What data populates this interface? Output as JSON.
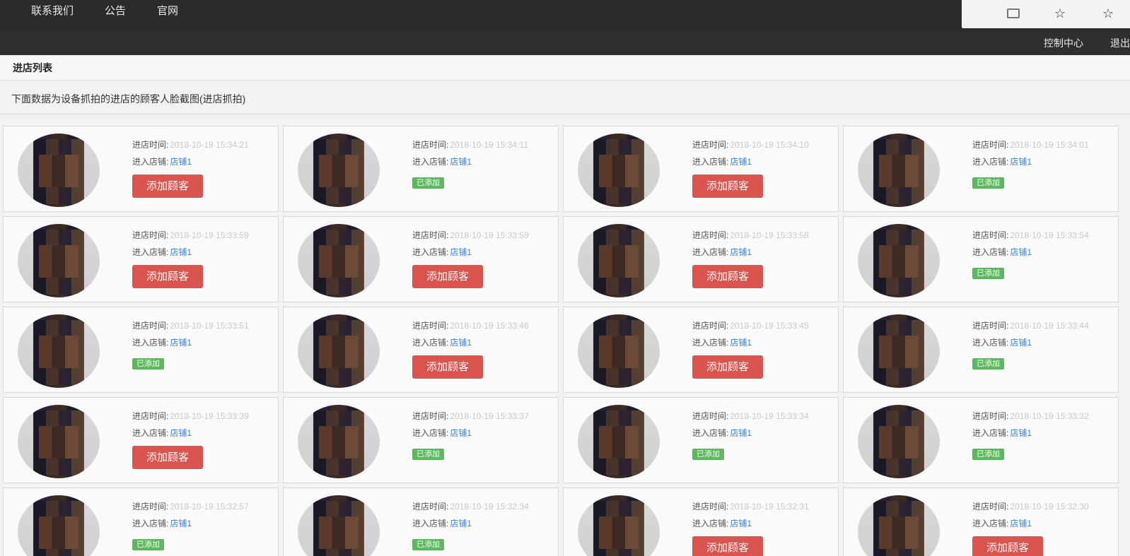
{
  "nav": {
    "items": [
      "联系我们",
      "公告",
      "官网"
    ]
  },
  "header_right": {
    "control_center": "控制中心",
    "logout": "退出"
  },
  "panel": {
    "title": "进店列表",
    "description": "下面数据为设备抓拍的进店的顾客人脸截图(进店抓拍)"
  },
  "labels": {
    "time_label": "进店时间:",
    "shop_label": "进入店铺:",
    "add_button": "添加顾客",
    "added_badge": "已添加"
  },
  "records": [
    {
      "time": "2018-10-19 15:34:21",
      "shop": "店铺1",
      "status": "add"
    },
    {
      "time": "2018-10-19 15:34:11",
      "shop": "店铺1",
      "status": "added"
    },
    {
      "time": "2018-10-19 15:34:10",
      "shop": "店铺1",
      "status": "add"
    },
    {
      "time": "2018-10-19 15:34:01",
      "shop": "店铺1",
      "status": "added"
    },
    {
      "time": "2018-10-19 15:33:59",
      "shop": "店铺1",
      "status": "add"
    },
    {
      "time": "2018-10-19 15:33:59",
      "shop": "店铺1",
      "status": "add"
    },
    {
      "time": "2018-10-19 15:33:58",
      "shop": "店铺1",
      "status": "add"
    },
    {
      "time": "2018-10-19 15:33:54",
      "shop": "店铺1",
      "status": "added"
    },
    {
      "time": "2018-10-19 15:33:51",
      "shop": "店铺1",
      "status": "added"
    },
    {
      "time": "2018-10-19 15:33:46",
      "shop": "店铺1",
      "status": "add"
    },
    {
      "time": "2018-10-19 15:33:45",
      "shop": "店铺1",
      "status": "add"
    },
    {
      "time": "2018-10-19 15:33:44",
      "shop": "店铺1",
      "status": "added"
    },
    {
      "time": "2018-10-19 15:33:39",
      "shop": "店铺1",
      "status": "add"
    },
    {
      "time": "2018-10-19 15:33:37",
      "shop": "店铺1",
      "status": "added"
    },
    {
      "time": "2018-10-19 15:33:34",
      "shop": "店铺1",
      "status": "added"
    },
    {
      "time": "2018-10-19 15:33:32",
      "shop": "店铺1",
      "status": "added"
    },
    {
      "time": "2018-10-19 15:32:57",
      "shop": "店铺1",
      "status": "added"
    },
    {
      "time": "2018-10-19 15:32:34",
      "shop": "店铺1",
      "status": "added"
    },
    {
      "time": "2018-10-19 15:32:31",
      "shop": "店铺1",
      "status": "add"
    },
    {
      "time": "2018-10-19 15:32:30",
      "shop": "店铺1",
      "status": "add"
    }
  ],
  "colors": {
    "add_button": "#d9534f",
    "added_badge": "#5cb85c",
    "shop_link": "#3b7fd0",
    "topbar": "#2b2b2b"
  },
  "icons": {
    "browser_action": "reader-icon",
    "bookmark": "star-icon",
    "menu": "star-menu-icon"
  }
}
